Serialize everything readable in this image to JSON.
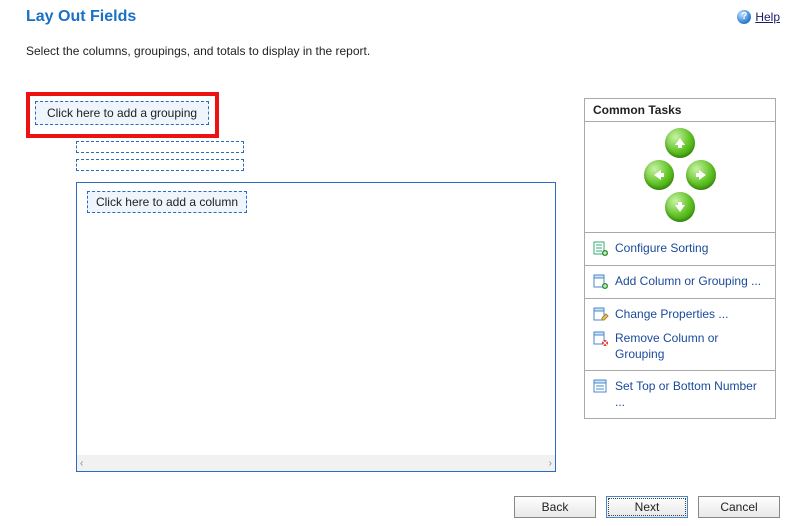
{
  "title": "Lay Out Fields",
  "help_label": "Help",
  "instruction": "Select the columns, groupings, and totals to display in the report.",
  "add_grouping_label": "Click here to add a grouping",
  "add_column_label": "Click here to add a column",
  "tasks": {
    "header": "Common Tasks",
    "configure_sorting": "Configure Sorting",
    "add_col_grouping": "Add Column or Grouping ...",
    "change_properties": "Change Properties ...",
    "remove_col_grouping": "Remove Column or Grouping",
    "set_top_bottom": "Set Top or Bottom Number ..."
  },
  "buttons": {
    "back": "Back",
    "next": "Next",
    "cancel": "Cancel"
  }
}
